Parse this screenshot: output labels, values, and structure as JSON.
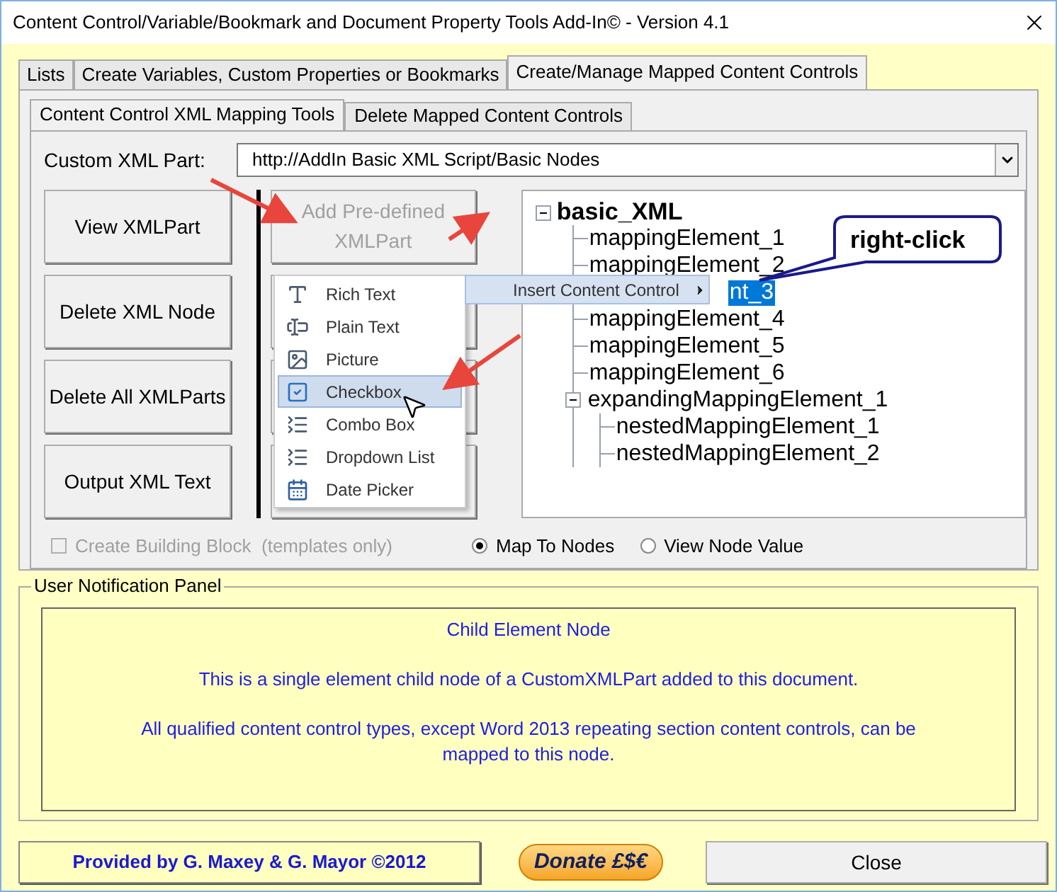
{
  "window": {
    "title": "Content Control/Variable/Bookmark and Document Property Tools Add-In© - Version 4.1"
  },
  "tabs": [
    {
      "label": "Lists",
      "selected": false
    },
    {
      "label": "Create Variables, Custom Properties or Bookmarks",
      "selected": false
    },
    {
      "label": "Create/Manage Mapped Content Controls",
      "selected": true
    }
  ],
  "subtabs": [
    {
      "label": "Content Control XML Mapping Tools",
      "selected": true
    },
    {
      "label": "Delete Mapped Content Controls",
      "selected": false
    }
  ],
  "custom_xml_part": {
    "label": "Custom XML Part:",
    "value": "http://AddIn Basic XML Script/Basic Nodes"
  },
  "left_buttons": [
    "View XMLPart",
    "Delete XML Node",
    "Delete All XMLParts",
    "Output XML Text"
  ],
  "add_button": {
    "label": "Add Pre-defined XMLPart",
    "disabled": true
  },
  "building_block": {
    "label": "Create Building Block  (templates only)",
    "checked": false,
    "disabled": true
  },
  "tree": {
    "label": "basic_XML",
    "expanded": true,
    "children": [
      {
        "label": "mappingElement_1",
        "selected": false
      },
      {
        "label": "mappingElement_2",
        "selected": false
      },
      {
        "label": "nt_3",
        "selected": true,
        "kind": "partial"
      },
      {
        "label": "mappingElement_4",
        "selected": false
      },
      {
        "label": "mappingElement_5",
        "selected": false
      },
      {
        "label": "mappingElement_6",
        "selected": false
      },
      {
        "label": "expandingMappingElement_1",
        "selected": false,
        "expanded": true,
        "children": [
          {
            "label": "nestedMappingElement_1",
            "selected": false
          },
          {
            "label": "nestedMappingElement_2",
            "selected": false
          }
        ]
      }
    ]
  },
  "radios": [
    {
      "label": "Map To Nodes",
      "selected": true
    },
    {
      "label": "View Node Value",
      "selected": false
    }
  ],
  "context_menu": {
    "label": "Insert Content Control",
    "items": [
      {
        "label": "Rich Text",
        "kind": "rich",
        "selected": false
      },
      {
        "label": "Plain Text",
        "kind": "plain",
        "selected": false
      },
      {
        "label": "Picture",
        "kind": "picture",
        "selected": false
      },
      {
        "label": "Checkbox",
        "kind": "checkbox",
        "selected": true
      },
      {
        "label": "Combo Box",
        "kind": "combo",
        "selected": false
      },
      {
        "label": "Dropdown List",
        "kind": "dropdown",
        "selected": false
      },
      {
        "label": "Date Picker",
        "kind": "date",
        "selected": false
      }
    ]
  },
  "callout": "right-click",
  "notification": {
    "title": "User Notification Panel",
    "lines": [
      "Child Element Node",
      "This is a single element child node of a CustomXMLPart added to this document.",
      "All qualified content control types, except Word 2013 repeating section content controls, can be mapped to this node."
    ]
  },
  "footer": {
    "credit": "Provided by G. Maxey & G. Mayor ©2012",
    "donate": "Donate £$€",
    "close": "Close"
  }
}
